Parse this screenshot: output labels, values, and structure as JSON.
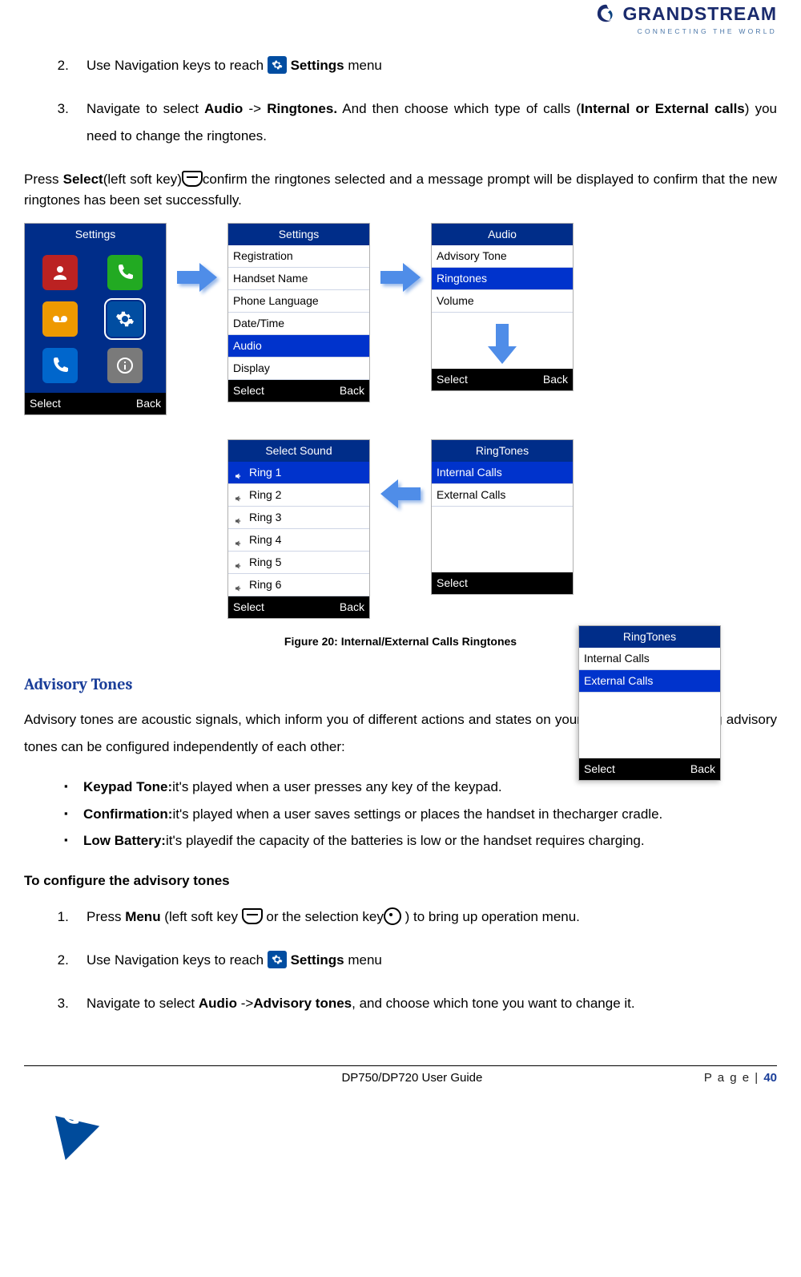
{
  "logo": {
    "name": "GRANDSTREAM",
    "tag": "CONNECTING THE WORLD"
  },
  "steps_a": {
    "s2_a": "Use Navigation keys to reach ",
    "s2_b": " Settings",
    "s2_c": " menu",
    "s3_a": "Navigate to select ",
    "s3_b": "Audio",
    "s3_arrow": " -> ",
    "s3_c": "Ringtones.",
    "s3_d": " And then choose which type of calls (",
    "s3_e": "Internal or External calls",
    "s3_f": ") you need to change the ringtones."
  },
  "para1": {
    "a": "Press ",
    "b": "Select",
    "c": "(left soft key)",
    "d": "confirm the ringtones selected and a message prompt will be displayed to confirm that the new ringtones has been set successfully."
  },
  "shots": {
    "settings_title": "Settings",
    "audio_title": "Audio",
    "selectsound_title": "Select Sound",
    "ringtones_title": "RingTones",
    "softkeys": {
      "left": "Select",
      "right": "Back"
    },
    "list_settings": [
      "Registration",
      "Handset Name",
      "Phone Language",
      "Date/Time",
      "Audio",
      "Display"
    ],
    "list_settings_sel": 4,
    "list_audio": [
      "Advisory Tone",
      "Ringtones",
      "Volume"
    ],
    "list_audio_sel": 1,
    "list_sounds": [
      "Ring 1",
      "Ring 2",
      "Ring 3",
      "Ring 4",
      "Ring 5",
      "Ring 6"
    ],
    "list_sounds_sel": 0,
    "list_rt_a": [
      "Internal Calls",
      "External Calls"
    ],
    "list_rt_a_sel": 0,
    "list_rt_b": [
      "Internal Calls",
      "External Calls"
    ],
    "list_rt_b_sel": 1
  },
  "figure_caption": "Figure 20: Internal/External Calls Ringtones",
  "section_title": "Advisory Tones",
  "para2": "Advisory tones are acoustic signals, which inform you of different actions and states on your handset. The following advisory tones can be configured independently of each other:",
  "tones": [
    {
      "name": "Keypad Tone:",
      "desc": "it's played when a user presses any key of the keypad."
    },
    {
      "name": "Confirmation:",
      "desc": "it's played when a user saves settings or places the handset in thecharger cradle."
    },
    {
      "name": "Low Battery:",
      "desc": "it's playedif the capacity of the batteries is low or the handset requires charging."
    }
  ],
  "configure_title": "To configure the advisory tones",
  "steps_b": {
    "s1_a": "Press ",
    "s1_b": "Menu",
    "s1_c": " (left soft key ",
    "s1_d": " or the selection key",
    "s1_e": " ) to bring up operation menu.",
    "s2_a": "Use Navigation keys to reach ",
    "s2_b": " Settings",
    "s2_c": " menu",
    "s3_a": "Navigate to select ",
    "s3_b": "Audio",
    "s3_arrow": " ->",
    "s3_c": "Advisory tones",
    "s3_d": ", and choose which tone you want to change it."
  },
  "footer": {
    "center": "DP750/DP720 User Guide",
    "right_label": "P a g e | ",
    "page": "40"
  }
}
